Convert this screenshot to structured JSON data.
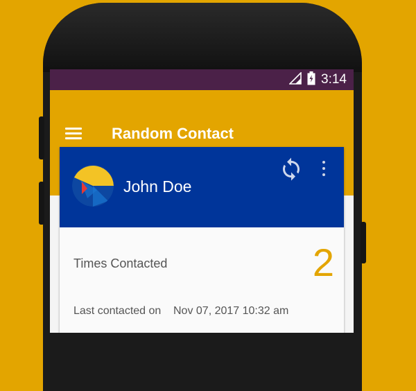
{
  "status_bar": {
    "time": "3:14",
    "icons": [
      "signal-icon",
      "battery-charging-icon"
    ]
  },
  "app_bar": {
    "title": "Random Contact",
    "menu_icon": "hamburger-menu-icon"
  },
  "contact_card": {
    "name": "John Doe",
    "refresh_icon": "refresh-icon",
    "overflow_icon": "more-vert-icon",
    "times_contacted_label": "Times Contacted",
    "times_contacted_value": "2",
    "last_contacted_label": "Last contacted on",
    "last_contacted_value": "Nov 07, 2017 10:32 am"
  },
  "colors": {
    "background": "#E3A500",
    "status_bar": "#4B2148",
    "app_bar": "#E3A500",
    "card_header": "#00359A",
    "accent_number": "#E3A500"
  }
}
